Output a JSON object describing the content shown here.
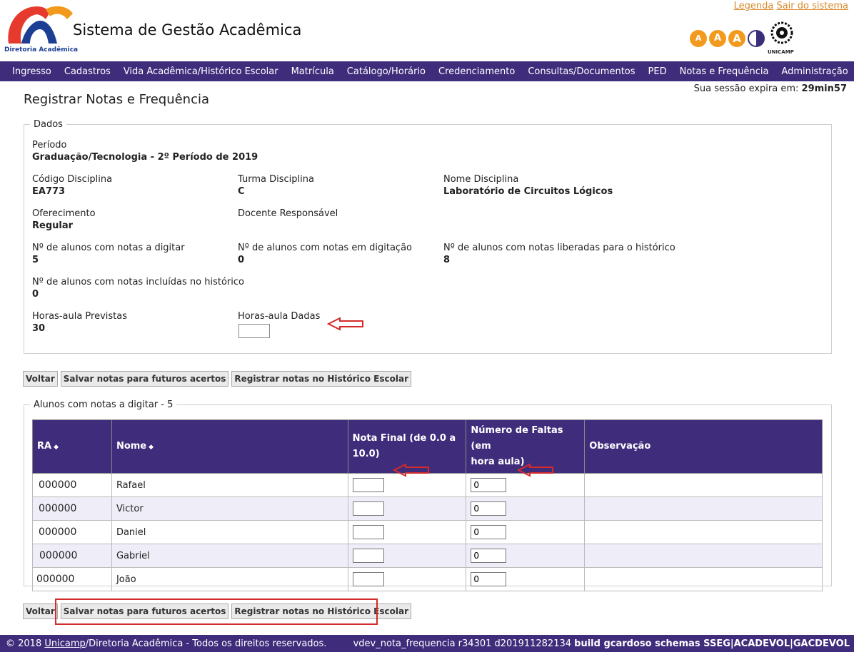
{
  "header": {
    "logo_text": "Diretoria Acadêmica",
    "app_title": "Sistema de Gestão Acadêmica",
    "legend_link": "Legenda",
    "logout_link": "Sair do sistema",
    "font_sizes": [
      "A",
      "A",
      "A"
    ],
    "unicamp_label": "UNICAMP",
    "accent_color": "#3f2d7c",
    "font_button_color": "#f39a1e"
  },
  "menu": [
    "Ingresso",
    "Cadastros",
    "Vida Acadêmica/Histórico Escolar",
    "Matrícula",
    "Catálogo/Horário",
    "Credenciamento",
    "Consultas/Documentos",
    "PED",
    "Notas e Frequência",
    "Administração"
  ],
  "session": {
    "label": "Sua sessão expira em:",
    "value": "29min57"
  },
  "page_title": "Registrar Notas e Frequência",
  "dados": {
    "legend": "Dados",
    "periodo": {
      "label": "Período",
      "value": "Graduação/Tecnologia - 2º Período de 2019"
    },
    "codigo": {
      "label": "Código Disciplina",
      "value": "EA773"
    },
    "turma": {
      "label": "Turma Disciplina",
      "value": "C"
    },
    "nome": {
      "label": "Nome Disciplina",
      "value": "Laboratório de Circuitos Lógicos"
    },
    "oferecimento": {
      "label": "Oferecimento",
      "value": "Regular"
    },
    "docente": {
      "label": "Docente Responsável",
      "value": ""
    },
    "a_digitar": {
      "label": "Nº de alunos com notas a digitar",
      "value": "5"
    },
    "em_digitacao": {
      "label": "Nº de alunos com notas em digitação",
      "value": "0"
    },
    "liberadas": {
      "label": "Nº de alunos com notas liberadas para o histórico",
      "value": "8"
    },
    "incluidas": {
      "label": "Nº de alunos com notas incluídas no histórico",
      "value": "0"
    },
    "horas_previstas": {
      "label": "Horas-aula Previstas",
      "value": "30"
    },
    "horas_dadas": {
      "label": "Horas-aula Dadas",
      "value": ""
    }
  },
  "buttons": {
    "voltar": "Voltar",
    "salvar": "Salvar notas para futuros acertos",
    "registrar": "Registrar notas no Histórico Escolar"
  },
  "alunos": {
    "legend": "Alunos com notas a digitar - 5",
    "columns": {
      "ra": "RA",
      "nome": "Nome",
      "nota_line1": "Nota Final (de 0.0 a",
      "nota_line2": "10.0)",
      "faltas_line1": "Número de Faltas (em",
      "faltas_line2": "hora aula)",
      "obs": "Observação"
    },
    "rows": [
      {
        "ra": "000000",
        "nome": "Rafael",
        "nota": "",
        "faltas": "0",
        "obs": ""
      },
      {
        "ra": "000000",
        "nome": "Victor",
        "nota": "",
        "faltas": "0",
        "obs": ""
      },
      {
        "ra": "000000",
        "nome": "Daniel",
        "nota": "",
        "faltas": "0",
        "obs": ""
      },
      {
        "ra": "000000",
        "nome": "Gabriel",
        "nota": "",
        "faltas": "0",
        "obs": ""
      },
      {
        "ra": "000000",
        "nome": "João",
        "nota": "",
        "faltas": "0",
        "obs": ""
      }
    ]
  },
  "footer": {
    "copyright_prefix": "© 2018 ",
    "unicamp_link": "Unicamp",
    "copyright_suffix": "/Diretoria Acadêmica - Todos os direitos reservados.",
    "build_prefix": "vdev_nota_frequencia r34301 d201911282134 ",
    "build_bold": "build gcardoso schemas SSEG|ACADEVOL|GACDEVOL"
  },
  "annotation_color": "#d42a2a"
}
